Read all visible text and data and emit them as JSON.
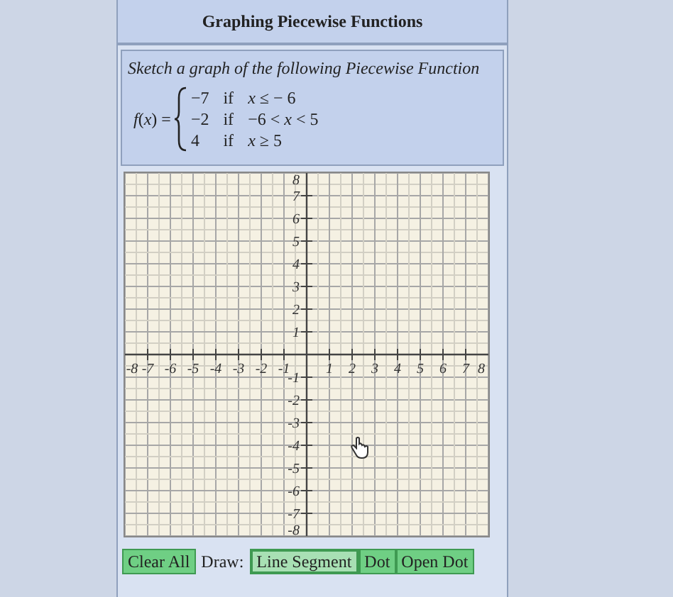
{
  "title": "Graphing Piecewise Functions",
  "prompt": "Sketch a graph of the following Piecewise Function",
  "function_label": "*f*(*x*) =",
  "pieces": [
    {
      "value": "−7",
      "word": "if",
      "condition": "*x* ≤ − 6"
    },
    {
      "value": "−2",
      "word": "if",
      "condition": "−6 < *x* < 5"
    },
    {
      "value": "4",
      "word": "if",
      "condition": "*x* ≥ 5"
    }
  ],
  "graph": {
    "x_labels": [
      "-8",
      "-7",
      "-6",
      "-5",
      "-4",
      "-3",
      "-2",
      "-1",
      "1",
      "2",
      "3",
      "4",
      "5",
      "6",
      "7",
      "8"
    ],
    "y_labels": [
      "8",
      "7",
      "6",
      "5",
      "4",
      "3",
      "2",
      "1",
      "-1",
      "-2",
      "-3",
      "-4",
      "-5",
      "-6",
      "-7",
      "-8"
    ]
  },
  "clear_button": "Clear All",
  "draw_label": "Draw:",
  "tools": [
    {
      "label": "Line Segment",
      "selected": true
    },
    {
      "label": "Dot",
      "selected": false
    },
    {
      "label": "Open Dot",
      "selected": false
    }
  ]
}
